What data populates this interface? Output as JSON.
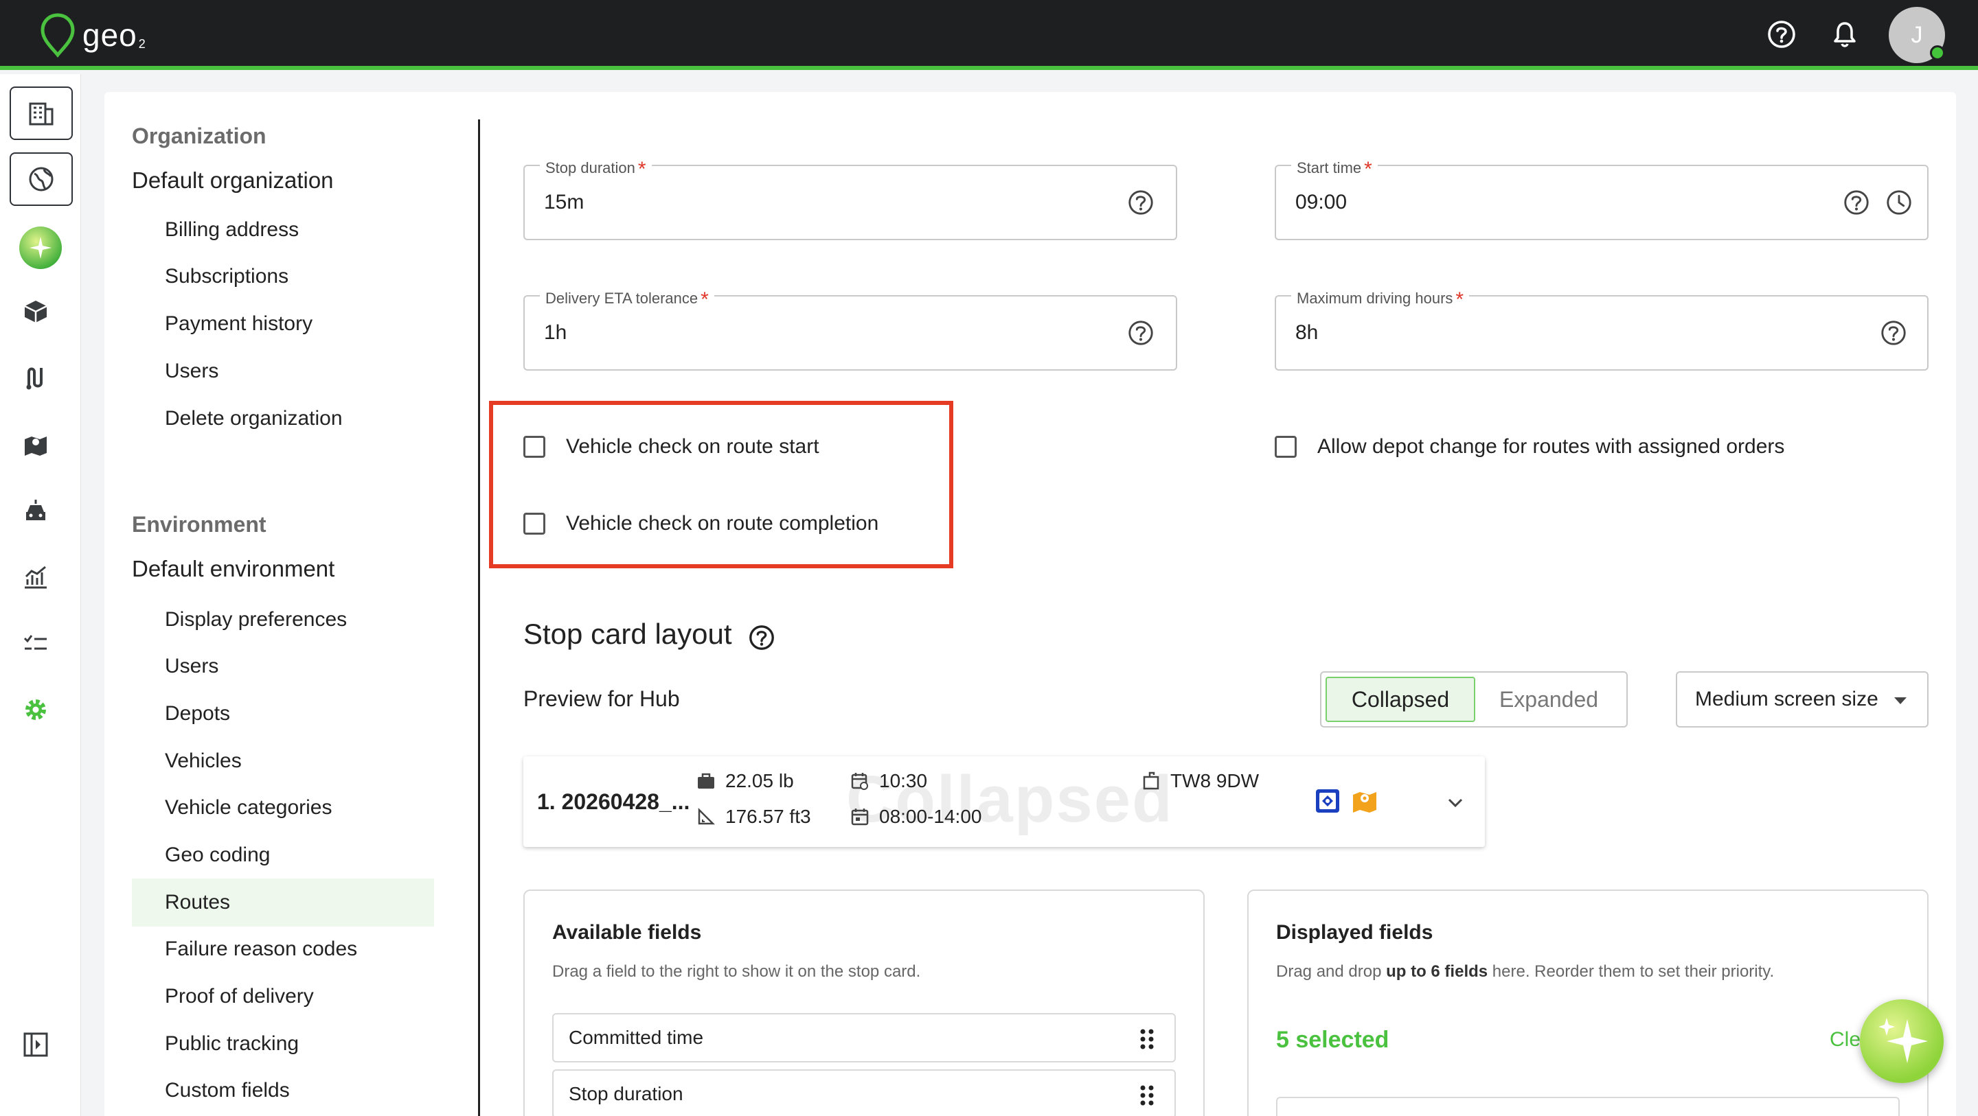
{
  "app": {
    "logo_text": "geo",
    "logo_sub": "2",
    "accent": "#4bc23f",
    "user_initial": "J"
  },
  "topbar_icons": [
    "help-icon",
    "bell-icon"
  ],
  "rail": [
    "buildings-icon",
    "globe-icon",
    "ai-sparkle-icon",
    "package-icon",
    "routes-icon",
    "map-icon",
    "vehicle-icon",
    "analytics-icon",
    "checklist-icon",
    "settings-icon",
    "collapse-sidebar-icon"
  ],
  "nav": {
    "organization": {
      "section": "Organization",
      "title": "Default organization",
      "items": [
        "Billing address",
        "Subscriptions",
        "Payment history",
        "Users",
        "Delete organization"
      ]
    },
    "environment": {
      "section": "Environment",
      "title": "Default environment",
      "items": [
        "Display preferences",
        "Users",
        "Depots",
        "Vehicles",
        "Vehicle categories",
        "Geo coding",
        "Routes",
        "Failure reason codes",
        "Proof of delivery",
        "Public tracking",
        "Custom fields"
      ],
      "active": "Routes"
    }
  },
  "form": {
    "stop_duration": {
      "label": "Stop duration",
      "required": "*",
      "value": "15m"
    },
    "start_time": {
      "label": "Start time",
      "required": "*",
      "value": "09:00"
    },
    "eta_tolerance": {
      "label": "Delivery ETA tolerance",
      "required": "*",
      "value": "1h"
    },
    "max_driving": {
      "label": "Maximum driving hours",
      "required": "*",
      "value": "8h"
    },
    "check_start": {
      "label": "Vehicle check on route start",
      "checked": false
    },
    "check_completion": {
      "label": "Vehicle check on route completion",
      "checked": false
    },
    "allow_depot_change": {
      "label": "Allow depot change for routes with assigned orders",
      "checked": false
    }
  },
  "stop_card": {
    "title": "Stop card layout",
    "preview_label": "Preview for Hub",
    "toggle": {
      "collapsed": "Collapsed",
      "expanded": "Expanded",
      "active": "Collapsed"
    },
    "screen_size": "Medium screen size",
    "preview": {
      "stop_name": "1. 20260428_...",
      "weight": "22.05 lb",
      "volume": "176.57 ft3",
      "eta": "10:30",
      "window": "08:00-14:00",
      "postcode": "TW8 9DW",
      "watermark": "Collapsed"
    }
  },
  "available_fields": {
    "title": "Available fields",
    "description": "Drag a field to the right to show it on the stop card.",
    "items": [
      "Committed time",
      "Stop duration"
    ]
  },
  "displayed_fields": {
    "title": "Displayed fields",
    "description_pre": "Drag and drop ",
    "description_bold": "up to 6 fields",
    "description_post": " here. Reorder them to set their priority.",
    "selected": "5 selected",
    "clear": "Cle"
  }
}
